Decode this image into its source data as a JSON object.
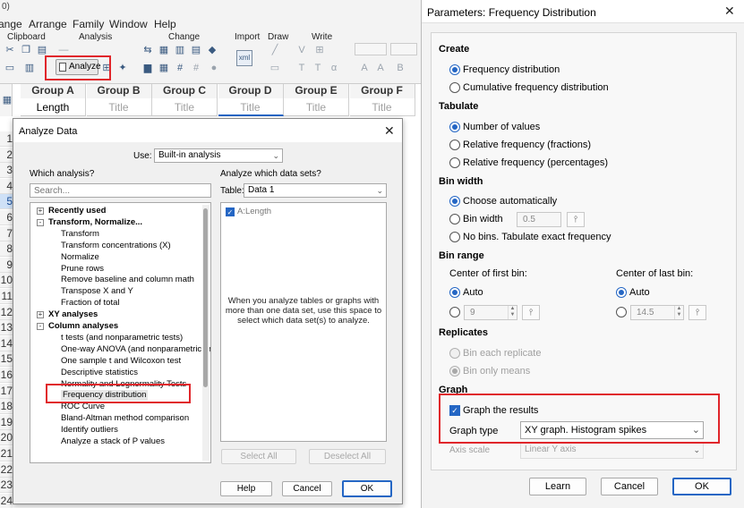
{
  "app": {
    "corner_text": "0)",
    "menu": [
      "ange",
      "Arrange",
      "Family",
      "Window",
      "Help"
    ],
    "ribbon_groups": [
      "Clipboard",
      "Analysis",
      "Change",
      "Import",
      "Draw",
      "Write"
    ],
    "analyze_label": "Analyze",
    "columns": [
      {
        "name": "Group A",
        "title": "Length"
      },
      {
        "name": "Group B",
        "title": "Title"
      },
      {
        "name": "Group C",
        "title": "Title"
      },
      {
        "name": "Group D",
        "title": "Title"
      },
      {
        "name": "Group E",
        "title": "Title"
      },
      {
        "name": "Group F",
        "title": "Title"
      }
    ],
    "rows": [
      "1",
      "2",
      "3",
      "4",
      "5",
      "6",
      "7",
      "8",
      "9",
      "10",
      "11",
      "12",
      "13",
      "14",
      "15",
      "16",
      "17",
      "18",
      "19",
      "20",
      "21",
      "22",
      "23",
      "24"
    ]
  },
  "analyze_dialog": {
    "title": "Analyze Data",
    "use_label": "Use:",
    "use_value": "Built-in analysis",
    "which_analysis_label": "Which analysis?",
    "search_placeholder": "Search...",
    "which_datasets_label": "Analyze which data sets?",
    "table_label": "Table:",
    "table_value": "Data 1",
    "tree": [
      {
        "text": "Recently used",
        "bold": true,
        "toggle": "+"
      },
      {
        "text": "Transform, Normalize...",
        "bold": true,
        "toggle": "-"
      },
      {
        "text": "Transform"
      },
      {
        "text": "Transform concentrations (X)"
      },
      {
        "text": "Normalize"
      },
      {
        "text": "Prune rows"
      },
      {
        "text": "Remove baseline and column math"
      },
      {
        "text": "Transpose X and Y"
      },
      {
        "text": "Fraction of total"
      },
      {
        "text": "XY analyses",
        "bold": true,
        "toggle": "+"
      },
      {
        "text": "Column analyses",
        "bold": true,
        "toggle": "-"
      },
      {
        "text": "t tests (and nonparametric tests)"
      },
      {
        "text": "One-way ANOVA (and nonparametric or"
      },
      {
        "text": "One sample t and Wilcoxon test"
      },
      {
        "text": "Descriptive statistics"
      },
      {
        "text": "Normality and Lognormality Tests"
      },
      {
        "text": "Frequency distribution"
      },
      {
        "text": "ROC Curve"
      },
      {
        "text": "Bland-Altman method comparison"
      },
      {
        "text": "Identify outliers"
      },
      {
        "text": "Analyze a stack of P values"
      }
    ],
    "dataset_item": "A:Length",
    "dataset_hint": "When you analyze tables or graphs with more than one data set, use this space to select which data set(s) to analyze.",
    "select_all": "Select All",
    "deselect_all": "Deselect All",
    "help": "Help",
    "cancel": "Cancel",
    "ok": "OK"
  },
  "params_dialog": {
    "title": "Parameters: Frequency Distribution",
    "create": {
      "heading": "Create",
      "options": [
        "Frequency distribution",
        "Cumulative frequency distribution"
      ],
      "selected": 0
    },
    "tabulate": {
      "heading": "Tabulate",
      "options": [
        "Number of values",
        "Relative frequency (fractions)",
        "Relative frequency (percentages)"
      ],
      "selected": 0
    },
    "bin_width": {
      "heading": "Bin width",
      "auto": "Choose automatically",
      "width_label": "Bin width",
      "width_value": "0.5",
      "no_bins": "No bins. Tabulate exact frequency"
    },
    "bin_range": {
      "heading": "Bin range",
      "first_label": "Center of first bin:",
      "last_label": "Center of last bin:",
      "auto": "Auto",
      "first_value": "9",
      "last_value": "14.5"
    },
    "replicates": {
      "heading": "Replicates",
      "options": [
        "Bin each replicate",
        "Bin only means"
      ]
    },
    "graph": {
      "heading": "Graph",
      "graph_results": "Graph the results",
      "graph_type_label": "Graph type",
      "graph_type_value": "XY graph. Histogram spikes",
      "axis_scale_label": "Axis scale",
      "axis_scale_value": "Linear Y axis"
    },
    "learn": "Learn",
    "cancel": "Cancel",
    "ok": "OK"
  },
  "colors": {
    "accent": "#2466c4",
    "highlight_box": "#e0262b"
  }
}
